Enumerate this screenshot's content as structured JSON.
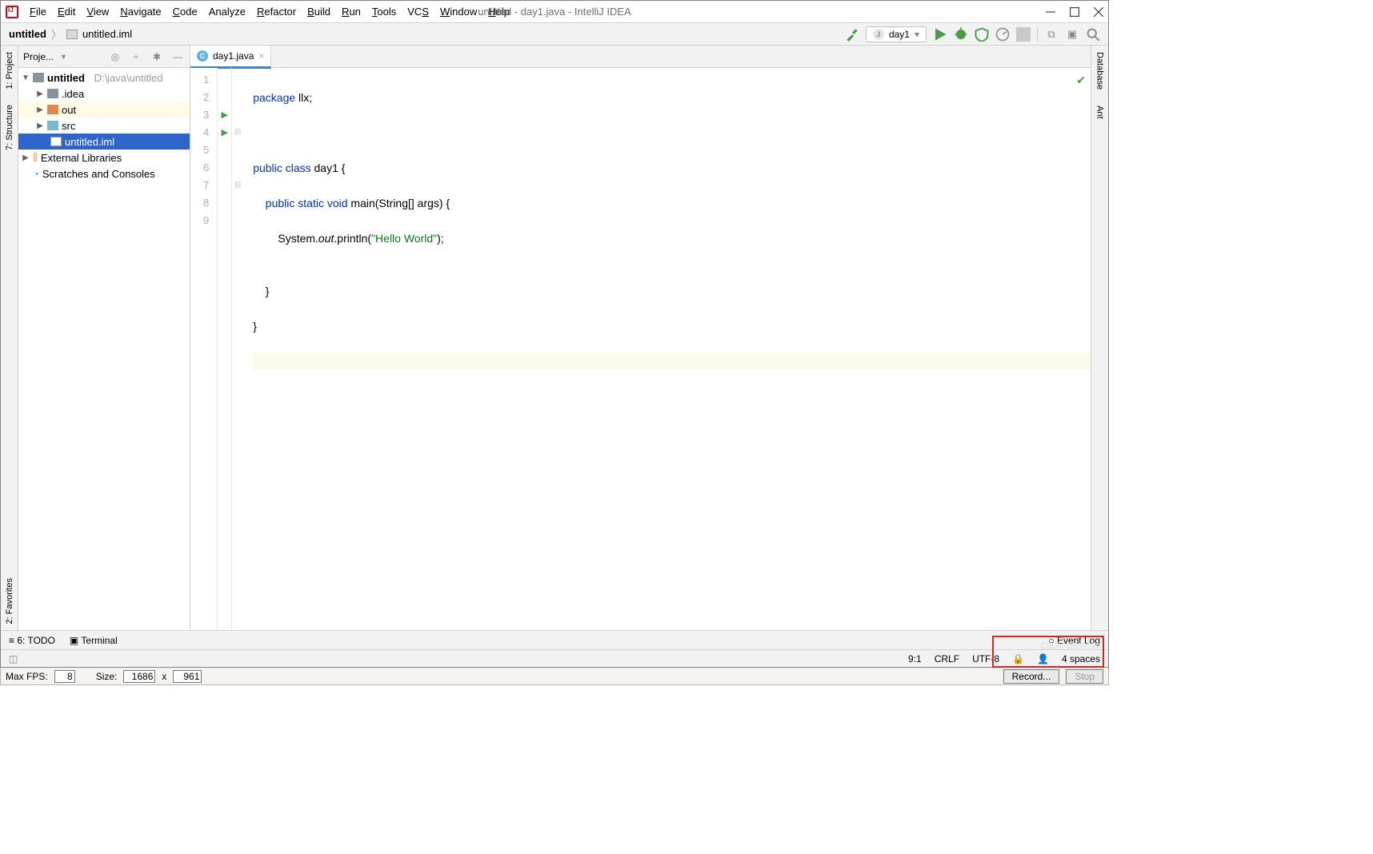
{
  "title": "untitled - day1.java - IntelliJ IDEA",
  "menu": [
    "File",
    "Edit",
    "View",
    "Navigate",
    "Code",
    "Analyze",
    "Refactor",
    "Build",
    "Run",
    "Tools",
    "VCS",
    "Window",
    "Help"
  ],
  "menu_mnem": [
    "F",
    "E",
    "V",
    "N",
    "C",
    "",
    "R",
    "B",
    "R",
    "T",
    "S",
    "W",
    "H"
  ],
  "breadcrumb": {
    "root": "untitled",
    "file": "untitled.iml"
  },
  "run_config": "day1",
  "project_panel": {
    "title": "Proje..."
  },
  "tree": {
    "root": {
      "name": "untitled",
      "path": "D:\\java\\untitled"
    },
    "idea": ".idea",
    "out": "out",
    "src": "src",
    "iml": "untitled.iml",
    "ext": "External Libraries",
    "scratch": "Scratches and Consoles"
  },
  "tab": {
    "name": "day1.java"
  },
  "gutter_lines": [
    "1",
    "2",
    "3",
    "4",
    "5",
    "6",
    "7",
    "8",
    "9"
  ],
  "code": {
    "l1a": "package",
    "l1b": " llx;",
    "l3a": "public",
    "l3b": " class",
    "l3c": " day1 {",
    "l4a": "    public",
    "l4b": " static",
    "l4c": " void",
    "l4d": " main",
    "l4e": "(String[] args) {",
    "l5a": "        System.",
    "l5b": "out",
    "l5c": ".println(",
    "l5d": "\"Hello World\"",
    "l5e": ");",
    "l6": "",
    "l7": "    }",
    "l8": "}"
  },
  "left_tabs": {
    "project": "1: Project",
    "structure": "7: Structure",
    "fav": "2: Favorites"
  },
  "right_tabs": {
    "db": "Database",
    "ant": "Ant"
  },
  "bottom": {
    "todo": "6: TODO",
    "terminal": "Terminal",
    "eventlog": "Event Log"
  },
  "status": {
    "pos": "9:1",
    "le": "CRLF",
    "enc": "UTF-8",
    "indent": "4 spaces"
  },
  "recorder": {
    "maxfps_label": "Max FPS:",
    "maxfps": "8",
    "size_label": "Size:",
    "w": "1686",
    "h": "961",
    "x": "x",
    "record": "Record...",
    "stop": "Stop"
  }
}
